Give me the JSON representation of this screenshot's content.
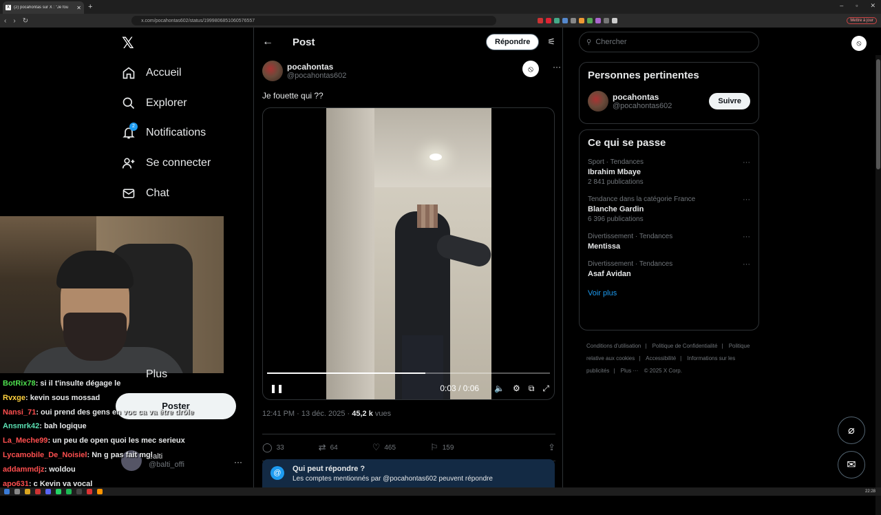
{
  "browser": {
    "tab_title": "(2) pocahontas sur X : \"Je fou",
    "url": "x.com/pocahontas602/status/1999806851060576557",
    "update_label": "Mettre à jour"
  },
  "nav": {
    "items": [
      {
        "label": "Accueil",
        "icon": "home-icon"
      },
      {
        "label": "Explorer",
        "icon": "search-icon"
      },
      {
        "label": "Notifications",
        "icon": "bell-icon",
        "badge": "2"
      },
      {
        "label": "Se connecter",
        "icon": "add-person-icon"
      },
      {
        "label": "Chat",
        "icon": "mail-icon"
      }
    ],
    "more_label": "Plus",
    "post_button": "Poster",
    "profile": {
      "name": "balti",
      "handle": "@balti_offi"
    }
  },
  "stream_chat": [
    {
      "user": "BotRix78",
      "text": "si il t'insulte dégage le",
      "color": "#4ee04e"
    },
    {
      "user": "Rvxge",
      "text": "kevin sous mossad",
      "color": "#ffd23f"
    },
    {
      "user": "Nansi_71",
      "text": "oui prend des gens en voc ca va être drôle",
      "color": "#ff4f4f"
    },
    {
      "user": "Ansmrk42",
      "text": "bah logique",
      "color": "#5be0b3"
    },
    {
      "user": "La_Meche99",
      "text": "un peu de open quoi les mec serieux",
      "color": "#ff4f4f"
    },
    {
      "user": "Lycamobile_De_Noisiel",
      "text": "Nn g pas fait mgl",
      "color": "#ff4f4f"
    },
    {
      "user": "addammdjz",
      "text": "woldou",
      "color": "#ff4f4f"
    },
    {
      "user": "apo631",
      "text": "c Kevin va vocal",
      "color": "#ff4f4f"
    }
  ],
  "post": {
    "header_title": "Post",
    "reply_button": "Répondre",
    "author_name": "pocahontas",
    "author_handle": "@pocahontas602",
    "text": "Je fouette qui ??",
    "video_time": "0:03 / 0:06",
    "video_progress": 0.56,
    "timestamp": "12:41 PM · 13 déc. 2025 ·",
    "views_count": "45,2 k",
    "views_label": "vues",
    "replies": "33",
    "reposts": "64",
    "likes": "465",
    "bookmarks": "159",
    "who_reply_title": "Qui peut répondre ?",
    "who_reply_sub": "Les comptes mentionnés par @pocahontas602 peuvent répondre"
  },
  "sidebar": {
    "search_placeholder": "Chercher",
    "relevant_title": "Personnes pertinentes",
    "relevant_person": {
      "name": "pocahontas",
      "handle": "@pocahontas602",
      "follow": "Suivre"
    },
    "trends_title": "Ce qui se passe",
    "trends": [
      {
        "category": "Sport · Tendances",
        "name": "Ibrahim Mbaye",
        "count": "2 841 publications"
      },
      {
        "category": "Tendance dans la catégorie France",
        "name": "Blanche Gardin",
        "count": "6 396 publications"
      },
      {
        "category": "Divertissement · Tendances",
        "name": "Mentissa",
        "count": ""
      },
      {
        "category": "Divertissement · Tendances",
        "name": "Asaf Avidan",
        "count": ""
      }
    ],
    "see_more": "Voir plus",
    "footer": [
      "Conditions d'utilisation",
      "|",
      "Politique de Confidentialité",
      "|",
      "Politique relative aux cookies",
      "|",
      "Accessibilité",
      "|",
      "Informations sur les publicités",
      "|",
      "Plus ···",
      "© 2025 X Corp."
    ]
  },
  "taskbar": {
    "clock": "22:28"
  }
}
